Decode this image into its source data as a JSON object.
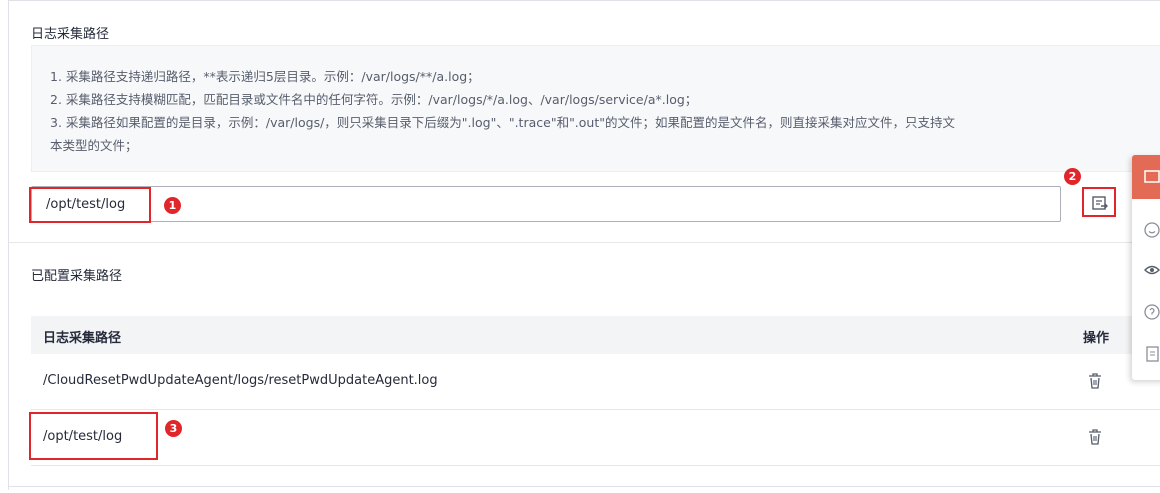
{
  "collection_path": {
    "title": "日志采集路径",
    "tips": [
      "1. 采集路径支持递归路径，**表示递归5层目录。示例：/var/logs/**/a.log；",
      "2. 采集路径支持模糊匹配，匹配目录或文件名中的任何字符。示例：/var/logs/*/a.log、/var/logs/service/a*.log；",
      "3. 采集路径如果配置的是目录，示例：/var/logs/，则只采集目录下后缀为\".log\"、\".trace\"和\".out\"的文件；如果配置的是文件名，则直接采集对应文件，只支持文",
      "本类型的文件；"
    ],
    "input_value": "/opt/test/log"
  },
  "configured": {
    "title": "已配置采集路径",
    "columns": [
      "日志采集路径",
      "操作"
    ],
    "rows": [
      {
        "path": "/CloudResetPwdUpdateAgent/logs/resetPwdUpdateAgent.log"
      },
      {
        "path": "/opt/test/log"
      }
    ]
  },
  "annotations": [
    "1",
    "2",
    "3"
  ],
  "colors": {
    "annotation_red": "#e0262b",
    "side_panel_accent": "#e36a55"
  },
  "icons": {
    "add_path": "add-path-icon",
    "delete": "trash-icon"
  }
}
